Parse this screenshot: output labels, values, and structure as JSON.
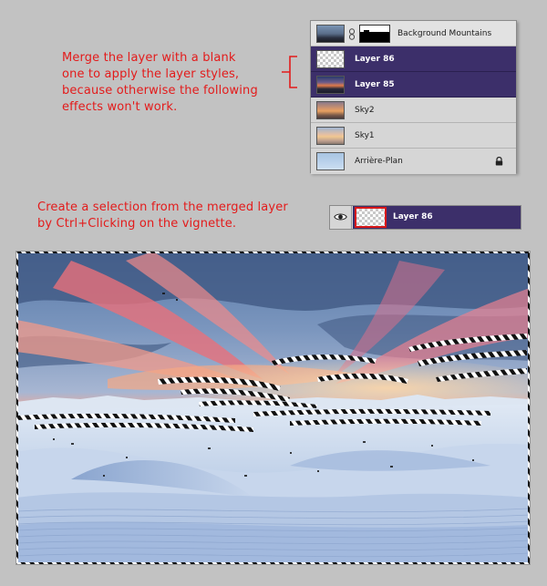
{
  "annotations": {
    "merge_note": [
      "Merge the layer with a blank",
      "one to apply the layer styles,",
      "because otherwise the following",
      "effects won't work."
    ],
    "selection_note": [
      "Create a selection from the merged layer",
      "by Ctrl+Clicking on the vignette."
    ],
    "note_color": "#e31b1b"
  },
  "layers_panel": {
    "layers": [
      {
        "name": "Background Mountains",
        "selected": false,
        "thumbnail": "mountains-thumbnail",
        "has_mask": true
      },
      {
        "name": "Layer 86",
        "selected": true,
        "thumbnail": "transparent-thumbnail"
      },
      {
        "name": "Layer 85",
        "selected": true,
        "thumbnail": "sunset-thumbnail"
      },
      {
        "name": "Sky2",
        "selected": false,
        "thumbnail": "orange-sky-thumbnail"
      },
      {
        "name": "Sky1",
        "selected": false,
        "thumbnail": "light-sky-thumbnail"
      },
      {
        "name": "Arrière-Plan",
        "selected": false,
        "thumbnail": "blue-thumbnail",
        "locked": true
      }
    ],
    "selected_color": "#3c2f6a"
  },
  "single_layer": {
    "name": "Layer 86",
    "visible_icon": "eye-icon",
    "highlight_color": "#d81818"
  },
  "canvas": {
    "selection": "marching-ants",
    "scene": "desert-dunes-sunset"
  }
}
